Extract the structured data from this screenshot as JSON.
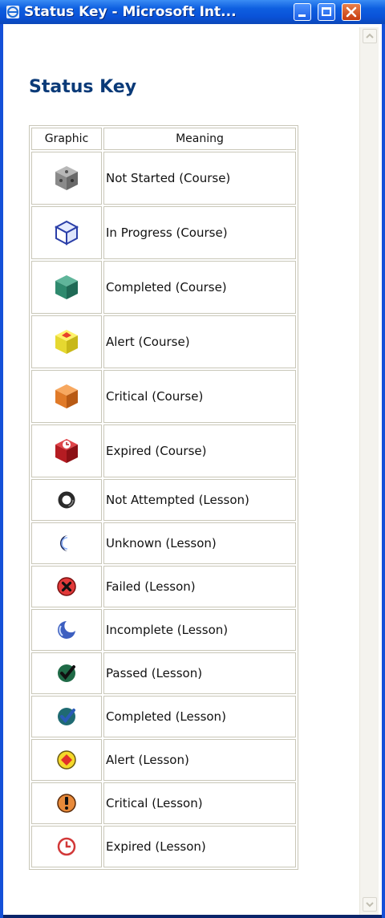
{
  "window": {
    "title": "Status Key - Microsoft Int..."
  },
  "page": {
    "heading": "Status Key"
  },
  "table": {
    "headers": [
      "Graphic",
      "Meaning"
    ],
    "rows": [
      {
        "icon": "gray-cube-icon",
        "meaning": "Not Started (Course)"
      },
      {
        "icon": "blue-outline-cube-icon",
        "meaning": "In Progress (Course)"
      },
      {
        "icon": "green-cube-icon",
        "meaning": "Completed (Course)"
      },
      {
        "icon": "yellow-alert-cube-icon",
        "meaning": "Alert (Course)"
      },
      {
        "icon": "orange-cube-icon",
        "meaning": "Critical (Course)"
      },
      {
        "icon": "red-clock-cube-icon",
        "meaning": "Expired (Course)"
      },
      {
        "icon": "ring-icon",
        "meaning": "Not Attempted (Lesson)"
      },
      {
        "icon": "crescent-dark-icon",
        "meaning": "Unknown (Lesson)"
      },
      {
        "icon": "red-x-circle-icon",
        "meaning": "Failed (Lesson)"
      },
      {
        "icon": "crescent-blue-icon",
        "meaning": "Incomplete (Lesson)"
      },
      {
        "icon": "green-check-circle-icon",
        "meaning": "Passed (Lesson)"
      },
      {
        "icon": "teal-check-circle-icon",
        "meaning": "Completed (Lesson)"
      },
      {
        "icon": "red-diamond-circle-icon",
        "meaning": "Alert (Lesson)"
      },
      {
        "icon": "orange-exclamation-circle-icon",
        "meaning": "Critical (Lesson)"
      },
      {
        "icon": "red-clock-icon",
        "meaning": "Expired (Lesson)"
      }
    ]
  }
}
